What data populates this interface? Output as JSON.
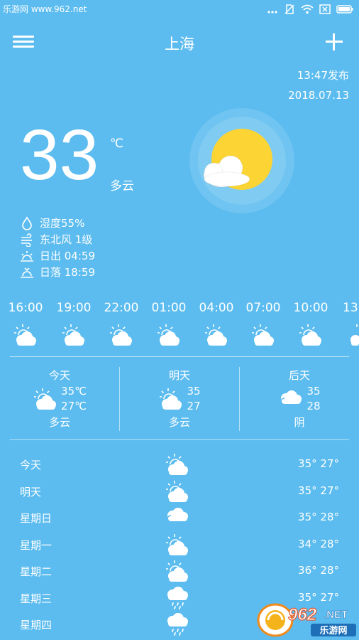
{
  "status_bar": {
    "watermark": "乐游网 www.962.net",
    "icons": [
      "signal-dots-icon",
      "no-sim-icon",
      "wifi-icon",
      "battery-x-icon",
      "battery-icon"
    ]
  },
  "header": {
    "menu_icon": "menu-icon",
    "city": "上海",
    "add_icon": "plus-icon"
  },
  "publish": {
    "time": "13:47发布",
    "date": "2018.07.13"
  },
  "current": {
    "temp": "33",
    "unit": "℃",
    "condition": "多云",
    "icon": "sun-cloud-icon",
    "details": [
      {
        "icon": "humidity-drop-icon",
        "text": "湿度55%"
      },
      {
        "icon": "wind-icon",
        "text": "东北风 1级"
      },
      {
        "icon": "sunrise-icon",
        "text": "日出 04:59"
      },
      {
        "icon": "sunset-icon",
        "text": "日落 18:59"
      }
    ]
  },
  "hourly": [
    {
      "time": "16:00",
      "icon": "partly-cloudy-icon"
    },
    {
      "time": "19:00",
      "icon": "partly-cloudy-icon"
    },
    {
      "time": "22:00",
      "icon": "partly-cloudy-icon"
    },
    {
      "time": "01:00",
      "icon": "partly-cloudy-icon"
    },
    {
      "time": "04:00",
      "icon": "partly-cloudy-icon"
    },
    {
      "time": "07:00",
      "icon": "partly-cloudy-icon"
    },
    {
      "time": "10:00",
      "icon": "partly-cloudy-icon"
    },
    {
      "time": "13",
      "icon": "partly-cloudy-icon"
    }
  ],
  "three_day": [
    {
      "name": "今天",
      "high": "35℃",
      "low": "27℃",
      "condition": "多云",
      "icon": "partly-cloudy-icon"
    },
    {
      "name": "明天",
      "high": "35",
      "low": "27",
      "condition": "多云",
      "icon": "partly-cloudy-icon"
    },
    {
      "name": "后天",
      "high": "35",
      "low": "28",
      "condition": "阴",
      "icon": "overcast-icon"
    }
  ],
  "weekly": [
    {
      "day": "今天",
      "temp": "35° 27°",
      "icon": "partly-cloudy-icon"
    },
    {
      "day": "明天",
      "temp": "35° 27°",
      "icon": "partly-cloudy-icon"
    },
    {
      "day": "星期日",
      "temp": "35° 28°",
      "icon": "overcast-icon"
    },
    {
      "day": "星期一",
      "temp": "34° 28°",
      "icon": "partly-cloudy-icon"
    },
    {
      "day": "星期二",
      "temp": "36° 28°",
      "icon": "partly-cloudy-icon"
    },
    {
      "day": "星期三",
      "temp": "35° 27°",
      "icon": "rain-icon"
    },
    {
      "day": "星期四",
      "temp": "",
      "icon": "rain-icon"
    }
  ],
  "watermark_badge": {
    "number": "962",
    "suffix": ".NET",
    "name": "乐游网"
  },
  "colors": {
    "background": "#5cbcef",
    "sun": "#fcd434",
    "text": "#ffffff"
  }
}
